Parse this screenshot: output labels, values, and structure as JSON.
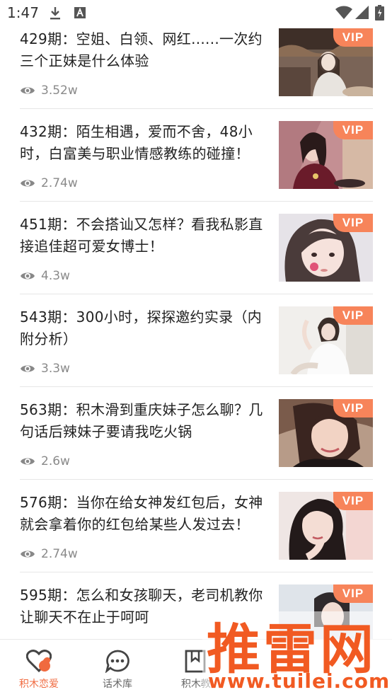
{
  "status_bar": {
    "time": "1:47",
    "icons": [
      "download-icon",
      "a-icon",
      "wifi-icon",
      "signal-icon",
      "battery-icon"
    ]
  },
  "articles": [
    {
      "title": "429期：空姐、白领、网红......一次约三个正妹是什么体验",
      "views": "3.52w",
      "badge": "VIP"
    },
    {
      "title": "432期：陌生相遇，爱而不舍，48小时，白富美与职业情感教练的碰撞！",
      "views": "2.74w",
      "badge": "VIP"
    },
    {
      "title": "451期：不会搭讪又怎样？看我私影直接追佳超可爱女博士！",
      "views": "4.3w",
      "badge": "VIP"
    },
    {
      "title": "543期：300小时，探探邀约实录（内附分析）",
      "views": "3.3w",
      "badge": "VIP"
    },
    {
      "title": "563期：积木滑到重庆妹子怎么聊？几句话后辣妹子要请我吃火锅",
      "views": "2.6w",
      "badge": "VIP"
    },
    {
      "title": "576期：当你在给女神发红包后，女神就会拿着你的红包给某些人发过去！",
      "views": "2.74w",
      "badge": "VIP"
    },
    {
      "title": "595期：怎么和女孩聊天，老司机教你让聊天不在止于呵呵",
      "views": "",
      "badge": "VIP"
    }
  ],
  "bottom_nav": [
    {
      "label": "积木恋爱",
      "icon": "heart-icon",
      "active": true
    },
    {
      "label": "话术库",
      "icon": "chat-bubble-icon",
      "active": false
    },
    {
      "label": "积木教",
      "icon": "bookmark-icon",
      "active": false
    }
  ],
  "watermark": {
    "title": "推雷网",
    "url": "www.tuilei.com"
  },
  "colors": {
    "accent": "#f06a3f",
    "vip": "#f7845a",
    "watermark": "#f15a22"
  }
}
